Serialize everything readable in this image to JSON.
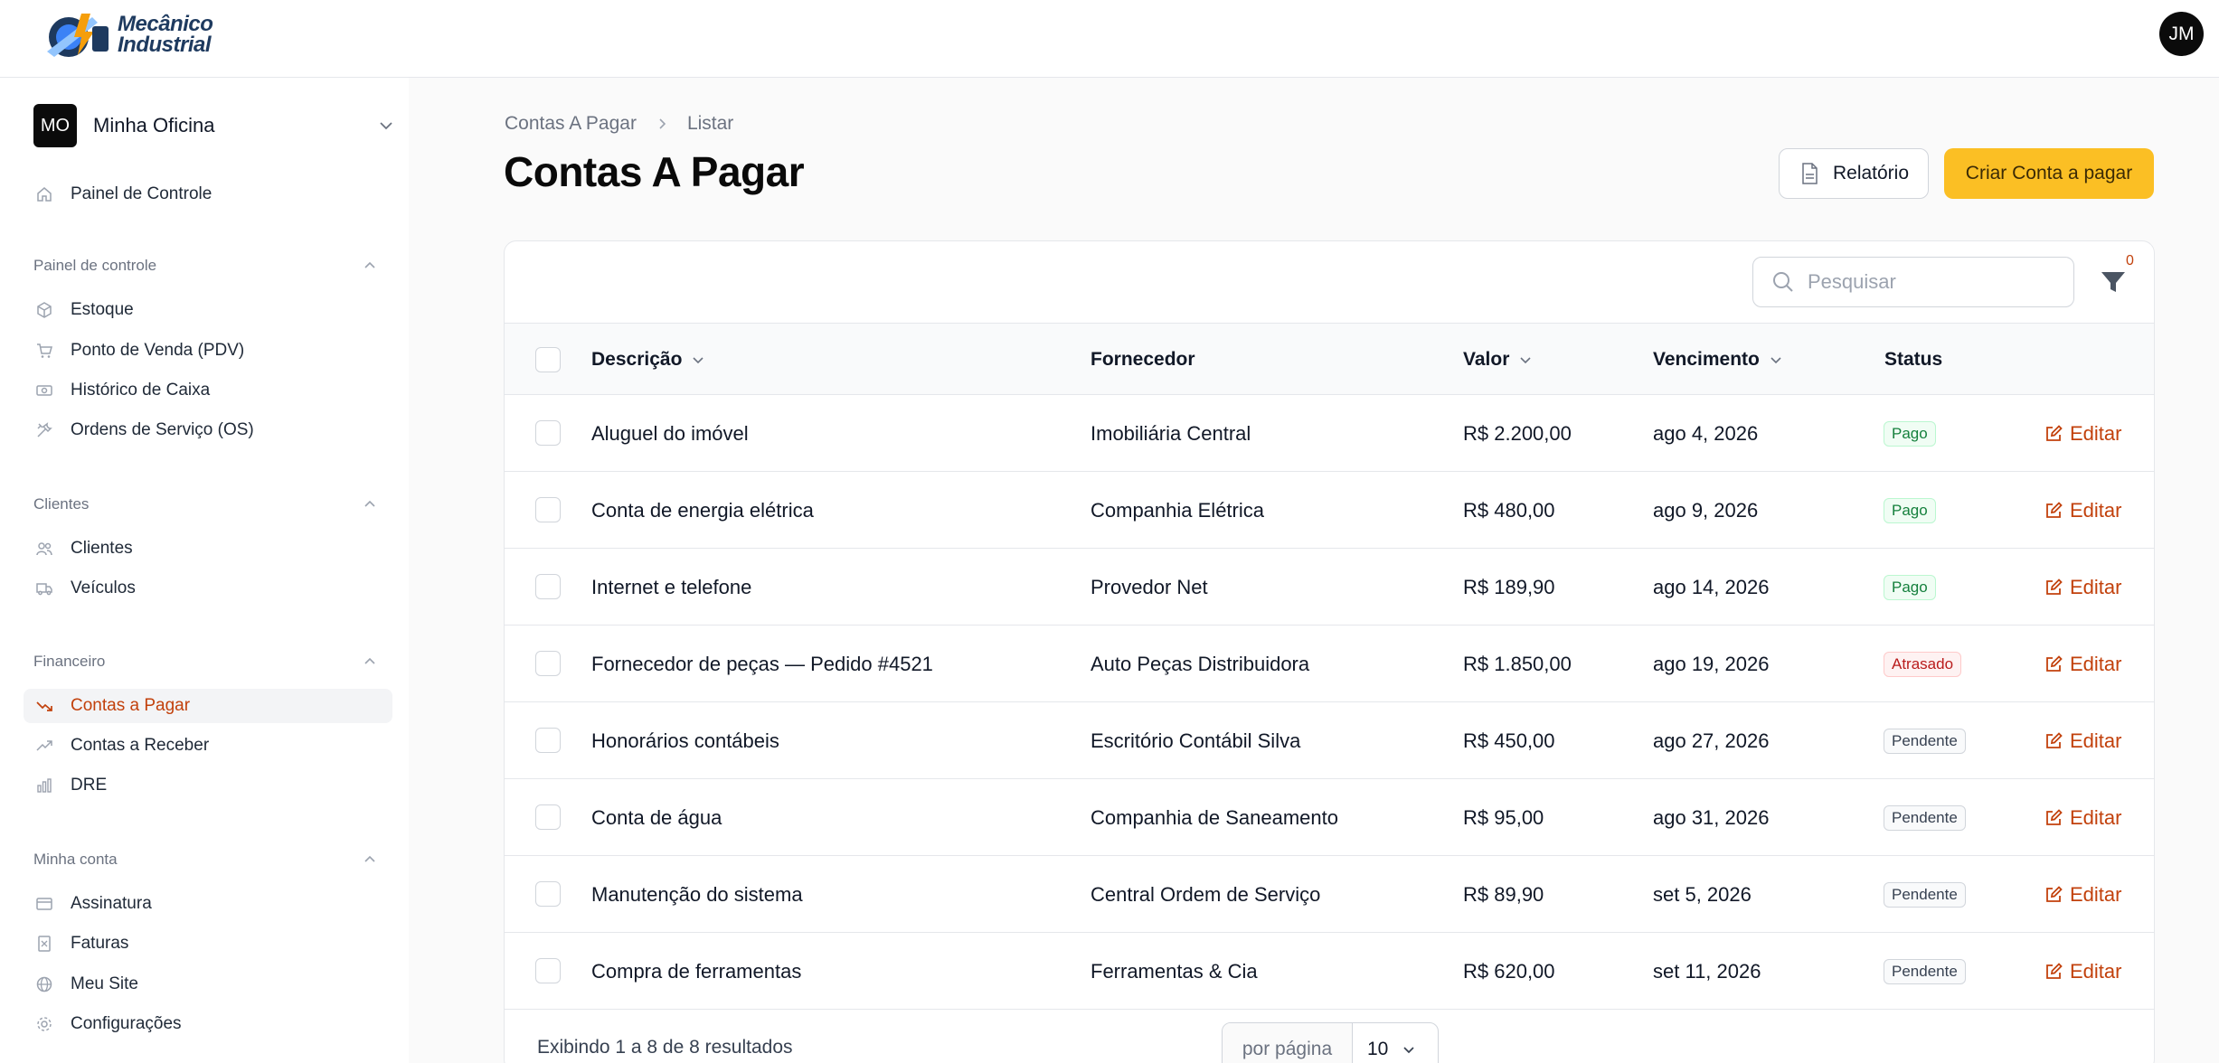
{
  "brand": {
    "line1": "Mecânico",
    "line2": "Industrial"
  },
  "user": {
    "initials": "JM"
  },
  "tenant": {
    "initials": "MO",
    "name": "Minha Oficina"
  },
  "sidebar": {
    "top_item": {
      "label": "Painel de Controle",
      "icon": "home-icon"
    },
    "groups": [
      {
        "title": "Painel de controle",
        "items": [
          {
            "label": "Estoque",
            "icon": "box-icon"
          },
          {
            "label": "Ponto de Venda (PDV)",
            "icon": "cart-icon"
          },
          {
            "label": "Histórico de Caixa",
            "icon": "cash-icon"
          },
          {
            "label": "Ordens de Serviço (OS)",
            "icon": "tools-icon"
          }
        ]
      },
      {
        "title": "Clientes",
        "items": [
          {
            "label": "Clientes",
            "icon": "users-icon"
          },
          {
            "label": "Veículos",
            "icon": "truck-icon"
          }
        ]
      },
      {
        "title": "Financeiro",
        "items": [
          {
            "label": "Contas a Pagar",
            "icon": "trending-down-icon",
            "active": true
          },
          {
            "label": "Contas a Receber",
            "icon": "trending-up-icon"
          },
          {
            "label": "DRE",
            "icon": "bar-chart-icon"
          }
        ]
      },
      {
        "title": "Minha conta",
        "items": [
          {
            "label": "Assinatura",
            "icon": "credit-card-icon"
          },
          {
            "label": "Faturas",
            "icon": "invoice-icon"
          },
          {
            "label": "Meu Site",
            "icon": "globe-icon"
          },
          {
            "label": "Configurações",
            "icon": "gear-icon"
          }
        ]
      }
    ]
  },
  "breadcrumb": {
    "parent": "Contas A Pagar",
    "current": "Listar"
  },
  "page": {
    "title": "Contas A Pagar"
  },
  "actions": {
    "report": "Relatório",
    "create": "Criar Conta a pagar"
  },
  "search": {
    "placeholder": "Pesquisar",
    "value": ""
  },
  "filter": {
    "count": "0"
  },
  "table": {
    "columns": [
      "Descrição",
      "Fornecedor",
      "Valor",
      "Vencimento",
      "Status"
    ],
    "edit_label": "Editar",
    "rows": [
      {
        "descricao": "Aluguel do imóvel",
        "fornecedor": "Imobiliária Central",
        "valor": "R$ 2.200,00",
        "vencimento": "ago 4, 2026",
        "status": "Pago",
        "status_kind": "pago"
      },
      {
        "descricao": "Conta de energia elétrica",
        "fornecedor": "Companhia Elétrica",
        "valor": "R$ 480,00",
        "vencimento": "ago 9, 2026",
        "status": "Pago",
        "status_kind": "pago"
      },
      {
        "descricao": "Internet e telefone",
        "fornecedor": "Provedor Net",
        "valor": "R$ 189,90",
        "vencimento": "ago 14, 2026",
        "status": "Pago",
        "status_kind": "pago"
      },
      {
        "descricao": "Fornecedor de peças — Pedido #4521",
        "fornecedor": "Auto Peças Distribuidora",
        "valor": "R$ 1.850,00",
        "vencimento": "ago 19, 2026",
        "status": "Atrasado",
        "status_kind": "atrasado"
      },
      {
        "descricao": "Honorários contábeis",
        "fornecedor": "Escritório Contábil Silva",
        "valor": "R$ 450,00",
        "vencimento": "ago 27, 2026",
        "status": "Pendente",
        "status_kind": "pendente"
      },
      {
        "descricao": "Conta de água",
        "fornecedor": "Companhia de Saneamento",
        "valor": "R$ 95,00",
        "vencimento": "ago 31, 2026",
        "status": "Pendente",
        "status_kind": "pendente"
      },
      {
        "descricao": "Manutenção do sistema",
        "fornecedor": "Central Ordem de Serviço",
        "valor": "R$ 89,90",
        "vencimento": "set 5, 2026",
        "status": "Pendente",
        "status_kind": "pendente"
      },
      {
        "descricao": "Compra de ferramentas",
        "fornecedor": "Ferramentas & Cia",
        "valor": "R$ 620,00",
        "vencimento": "set 11, 2026",
        "status": "Pendente",
        "status_kind": "pendente"
      }
    ]
  },
  "footer": {
    "summary": "Exibindo 1 a 8 de 8 resultados",
    "per_page_label": "por página",
    "per_page_value": "10"
  },
  "colors": {
    "accent": "#c2410c",
    "primary_button": "#fbbf24"
  }
}
